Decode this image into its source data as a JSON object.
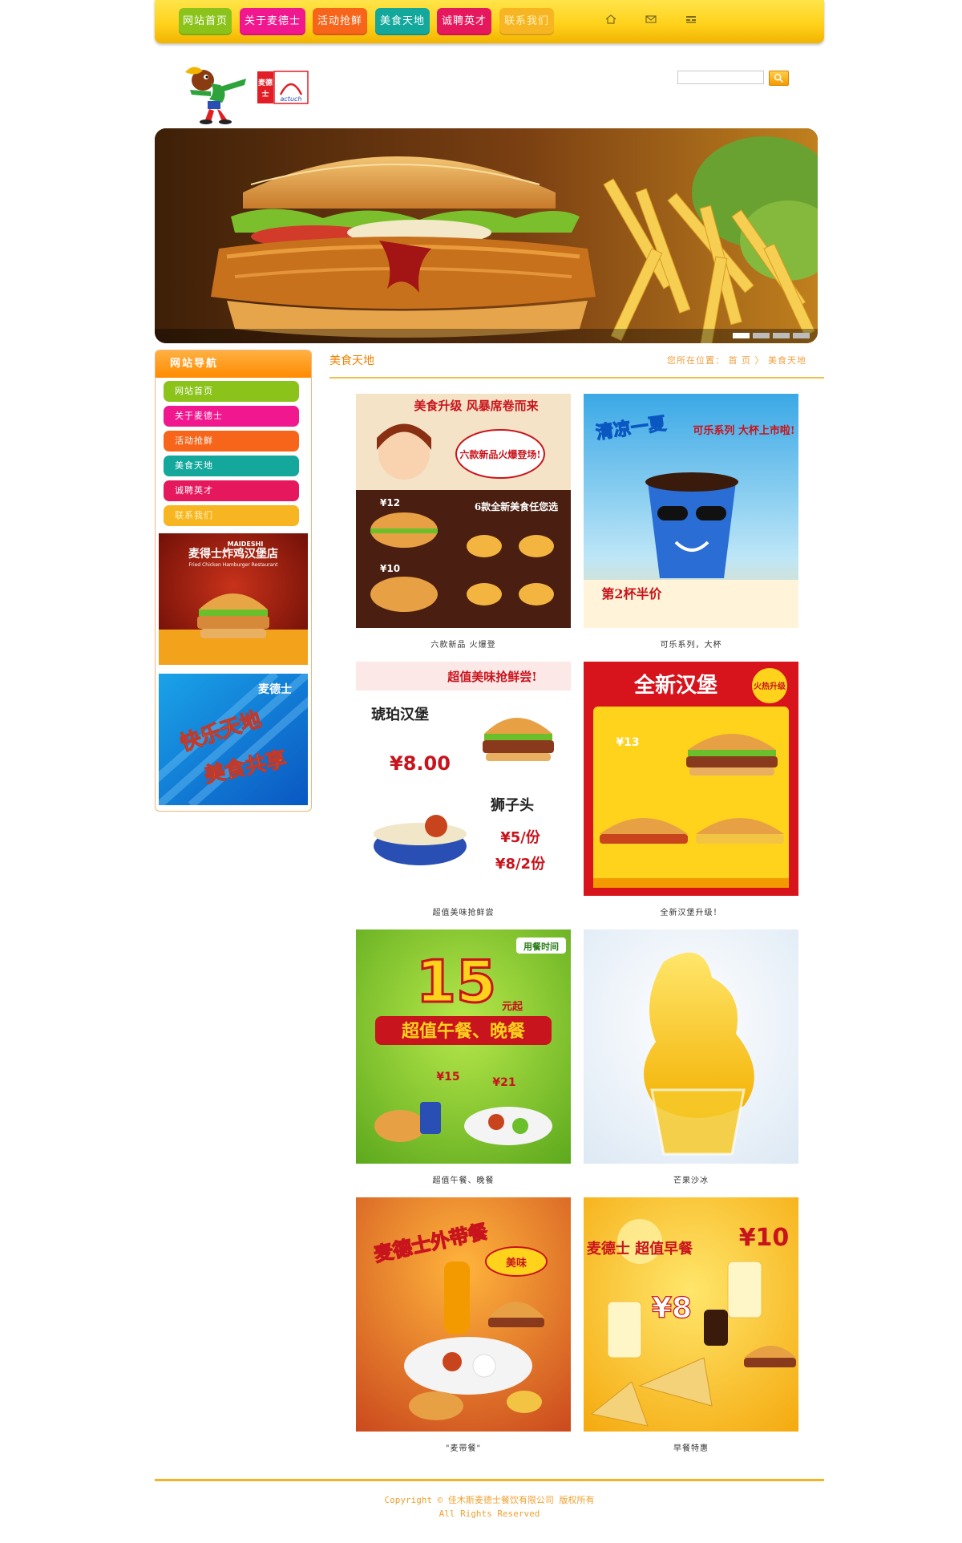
{
  "nav": {
    "items": [
      "网站首页",
      "关于麦德士",
      "活动抢鲜",
      "美食天地",
      "诚聘英才",
      "联系我们"
    ],
    "tools": [
      "home-icon",
      "mail-icon",
      "sitemap-icon"
    ]
  },
  "header": {
    "brand_text": "麦德士",
    "brand_logo_text": "actuch",
    "search": {
      "value": "",
      "placeholder": ""
    }
  },
  "banner": {
    "slide_count": 4,
    "active_slide": 1
  },
  "sidebar": {
    "title": "网站导航",
    "items": [
      "网站首页",
      "关于麦德士",
      "活动抢鲜",
      "美食天地",
      "诚聘英才",
      "联系我们"
    ],
    "ads": [
      {
        "title": "麦得士炸鸡汉堡店",
        "subtitle_en": "MAIDESHI",
        "tagline_en": "Fried Chicken Hamburger Restaurant"
      },
      {
        "brand": "麦德士",
        "line1": "快乐天地",
        "line2": "美食共享"
      }
    ]
  },
  "main": {
    "title": "美食天地",
    "breadcrumb": {
      "prefix": "您所在位置：",
      "home": "首 页",
      "sep": "〉",
      "current": "美食天地"
    },
    "products": [
      {
        "caption": "六款新品 火爆登",
        "headline": "美食升级 风暴席卷而来",
        "bubble": "六款新品火爆登场!",
        "sub": "6款全新美食任您选",
        "price_a": "¥12",
        "price_b": "¥10"
      },
      {
        "caption": "可乐系列，大杯",
        "headline": "清凉一夏",
        "tag": "可乐系列 大杯上市啦!",
        "sub": "第2杯半价"
      },
      {
        "caption": "超值美味抢鲜尝",
        "headline": "超值美味抢鲜尝!",
        "item_a": "琥珀汉堡",
        "price_a": "¥8.00",
        "item_b": "狮子头",
        "price_b": "¥5/份",
        "price_c": "¥8/2份"
      },
      {
        "caption": "全新汉堡升级！",
        "headline": "全新汉堡",
        "tag": "火热升级",
        "price": "¥13"
      },
      {
        "caption": "超值午餐、晚餐",
        "big_number": "15",
        "unit": "元起",
        "headline": "超值午餐、晚餐",
        "time_label": "用餐时间",
        "price_a": "¥15",
        "price_b": "¥21"
      },
      {
        "caption": "芒果沙冰"
      },
      {
        "caption": "\"麦带餐\"",
        "headline": "麦德士外带餐",
        "tag": "美味"
      },
      {
        "caption": "早餐特惠",
        "headline": "麦德士 超值早餐",
        "price_a": "¥10",
        "price_b": "¥8"
      }
    ]
  },
  "footer": {
    "line1": "Copyright © 佳木斯麦德士餐饮有限公司 版权所有",
    "line2": "All Rights Reserved"
  }
}
